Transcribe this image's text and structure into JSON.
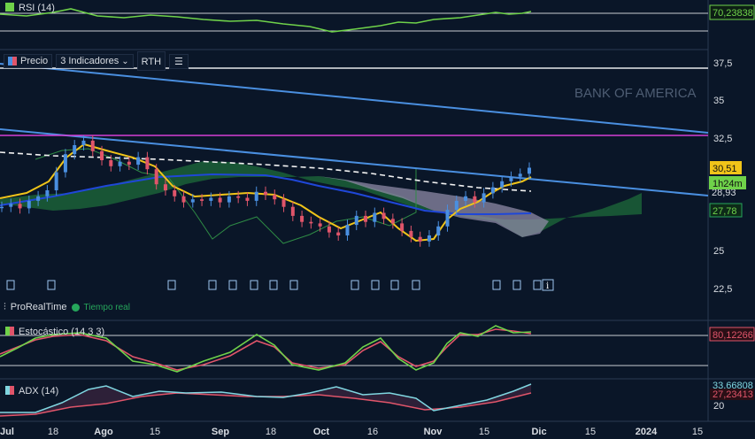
{
  "rsi": {
    "label": "RSI (14)",
    "value": "70,23838",
    "color": "#6fd24a",
    "badge_color": "#6fd24a"
  },
  "toolbar": {
    "price_label": "Precio",
    "indicators_label": "3 Indicadores",
    "rth_label": "RTH",
    "list_icon": "list-icon"
  },
  "watermark": "BANK OF AMERICA",
  "price_axis": {
    "ticks": [
      "37,5",
      "35",
      "32,5",
      "25",
      "22,5"
    ],
    "partial_ticks": [
      "28,93"
    ]
  },
  "badges": {
    "last_price": "30,51",
    "countdown": "1h24m",
    "green_level": "27,78",
    "last_price_color": "#f0c419",
    "countdown_color": "#6fd24a",
    "green_level_color": "#26a65b"
  },
  "branding": {
    "name": "ProRealTime",
    "status": "Tiempo real",
    "status_color": "#26a65b"
  },
  "stochastic": {
    "label": "Estocástico (14 3 3)",
    "value": "80,12266",
    "k_color": "#6fd24a",
    "d_color": "#e0556a"
  },
  "adx": {
    "label": "ADX (14)",
    "value1": "33,66808",
    "value2": "27,23413",
    "tick": "20",
    "adx_color": "#7fd6e0",
    "di_color": "#e0556a"
  },
  "x_axis": {
    "labels": [
      "Jul",
      "18",
      "Ago",
      "15",
      "Sep",
      "18",
      "Oct",
      "16",
      "Nov",
      "15",
      "Dic",
      "15",
      "2024",
      "15"
    ]
  },
  "chart_data": {
    "type": "candlestick",
    "title": "BANK OF AMERICA",
    "y_ticks": [
      22.5,
      25,
      27.5,
      30,
      32.5,
      35,
      37.5
    ],
    "ylim": [
      22,
      38.5
    ],
    "series": [
      {
        "name": "Precio",
        "values": [
          27.9,
          28.1,
          27.8,
          28.3,
          28.6,
          29.0,
          30.2,
          31.4,
          32.0,
          32.3,
          31.6,
          31.0,
          30.6,
          30.9,
          30.7,
          31.2,
          30.4,
          29.4,
          29.0,
          28.6,
          28.2,
          28.4,
          28.3,
          28.5,
          28.2,
          28.6,
          28.5,
          28.3,
          28.9,
          28.7,
          28.4,
          27.9,
          27.3,
          26.9,
          26.8,
          26.6,
          26.2,
          26.0,
          26.7,
          27.3,
          26.9,
          27.5,
          27.1,
          26.8,
          26.3,
          25.9,
          25.6,
          26.0,
          26.6,
          27.7,
          28.3,
          28.6,
          28.2,
          28.8,
          29.2,
          29.6,
          29.9,
          30.1,
          30.5
        ]
      },
      {
        "name": "Precio_Precio",
        "values": [
          32.55,
          32.55
        ]
      }
    ],
    "annotations": [
      "30,51",
      "1h24m",
      "27,78"
    ]
  }
}
